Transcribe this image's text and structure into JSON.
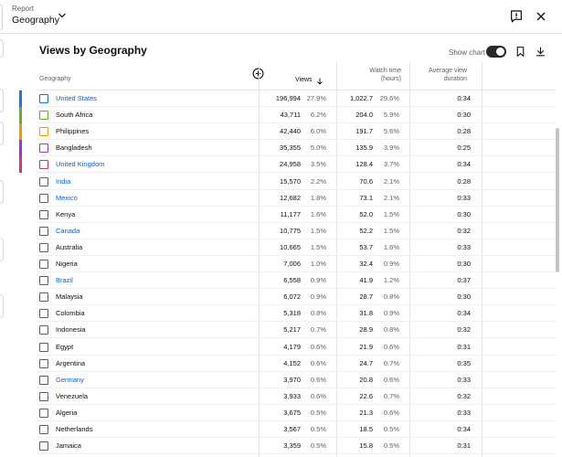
{
  "header": {
    "report_label": "Report",
    "report_value": "Geography"
  },
  "card": {
    "title": "Views by Geography",
    "show_chart_label": "Show chart",
    "show_chart_on": true
  },
  "table": {
    "headers": {
      "geography": "Geography",
      "views": "Views",
      "watch_time": "Watch time (hours)",
      "avg_view_duration": "Average view duration"
    },
    "sort": "views-descending",
    "rows": [
      {
        "name": "United States",
        "link": true,
        "color": "#1a73e8",
        "views": "196,994",
        "views_pct": "27.9%",
        "watch": "1,022.7",
        "watch_pct": "29.6%",
        "avg": "0:34"
      },
      {
        "name": "South Africa",
        "link": false,
        "color": "#5fb023",
        "views": "43,711",
        "views_pct": "6.2%",
        "watch": "204.0",
        "watch_pct": "5.9%",
        "avg": "0:30"
      },
      {
        "name": "Philippines",
        "link": false,
        "color": "#f29900",
        "views": "42,440",
        "views_pct": "6.0%",
        "watch": "191.7",
        "watch_pct": "5.6%",
        "avg": "0:28"
      },
      {
        "name": "Bangladesh",
        "link": false,
        "color": "#9334e6",
        "views": "35,355",
        "views_pct": "5.0%",
        "watch": "135.9",
        "watch_pct": "3.9%",
        "avg": "0:25"
      },
      {
        "name": "United Kingdom",
        "link": true,
        "color": "#d7395d",
        "views": "24,958",
        "views_pct": "3.5%",
        "watch": "128.4",
        "watch_pct": "3.7%",
        "avg": "0:34"
      },
      {
        "name": "India",
        "link": true,
        "color": "",
        "views": "15,570",
        "views_pct": "2.2%",
        "watch": "70.6",
        "watch_pct": "2.1%",
        "avg": "0:28"
      },
      {
        "name": "Mexico",
        "link": true,
        "color": "",
        "views": "12,682",
        "views_pct": "1.8%",
        "watch": "73.1",
        "watch_pct": "2.1%",
        "avg": "0:33"
      },
      {
        "name": "Kenya",
        "link": false,
        "color": "",
        "views": "11,177",
        "views_pct": "1.6%",
        "watch": "52.0",
        "watch_pct": "1.5%",
        "avg": "0:30"
      },
      {
        "name": "Canada",
        "link": true,
        "color": "",
        "views": "10,775",
        "views_pct": "1.5%",
        "watch": "52.2",
        "watch_pct": "1.5%",
        "avg": "0:32"
      },
      {
        "name": "Australia",
        "link": false,
        "color": "",
        "views": "10,665",
        "views_pct": "1.5%",
        "watch": "53.7",
        "watch_pct": "1.6%",
        "avg": "0:33"
      },
      {
        "name": "Nigeria",
        "link": false,
        "color": "",
        "views": "7,006",
        "views_pct": "1.0%",
        "watch": "32.4",
        "watch_pct": "0.9%",
        "avg": "0:30"
      },
      {
        "name": "Brazil",
        "link": true,
        "color": "",
        "views": "6,558",
        "views_pct": "0.9%",
        "watch": "41.9",
        "watch_pct": "1.2%",
        "avg": "0:37"
      },
      {
        "name": "Malaysia",
        "link": false,
        "color": "",
        "views": "6,072",
        "views_pct": "0.9%",
        "watch": "28.7",
        "watch_pct": "0.8%",
        "avg": "0:30"
      },
      {
        "name": "Colombia",
        "link": false,
        "color": "",
        "views": "5,318",
        "views_pct": "0.8%",
        "watch": "31.8",
        "watch_pct": "0.9%",
        "avg": "0:34"
      },
      {
        "name": "Indonesia",
        "link": false,
        "color": "",
        "views": "5,217",
        "views_pct": "0.7%",
        "watch": "28.9",
        "watch_pct": "0.8%",
        "avg": "0:32"
      },
      {
        "name": "Egypt",
        "link": false,
        "color": "",
        "views": "4,179",
        "views_pct": "0.6%",
        "watch": "21.9",
        "watch_pct": "0.6%",
        "avg": "0:31"
      },
      {
        "name": "Argentina",
        "link": false,
        "color": "",
        "views": "4,152",
        "views_pct": "0.6%",
        "watch": "24.7",
        "watch_pct": "0.7%",
        "avg": "0:35"
      },
      {
        "name": "Germany",
        "link": true,
        "color": "",
        "views": "3,970",
        "views_pct": "0.6%",
        "watch": "20.8",
        "watch_pct": "0.6%",
        "avg": "0:33"
      },
      {
        "name": "Venezuela",
        "link": false,
        "color": "",
        "views": "3,933",
        "views_pct": "0.6%",
        "watch": "22.6",
        "watch_pct": "0.7%",
        "avg": "0:32"
      },
      {
        "name": "Algeria",
        "link": false,
        "color": "",
        "views": "3,675",
        "views_pct": "0.5%",
        "watch": "21.3",
        "watch_pct": "0.6%",
        "avg": "0:33"
      },
      {
        "name": "Netherlands",
        "link": false,
        "color": "",
        "views": "3,567",
        "views_pct": "0.5%",
        "watch": "18.5",
        "watch_pct": "0.5%",
        "avg": "0:34"
      },
      {
        "name": "Jamaica",
        "link": false,
        "color": "",
        "views": "3,359",
        "views_pct": "0.5%",
        "watch": "15.8",
        "watch_pct": "0.5%",
        "avg": "0:31"
      }
    ]
  }
}
